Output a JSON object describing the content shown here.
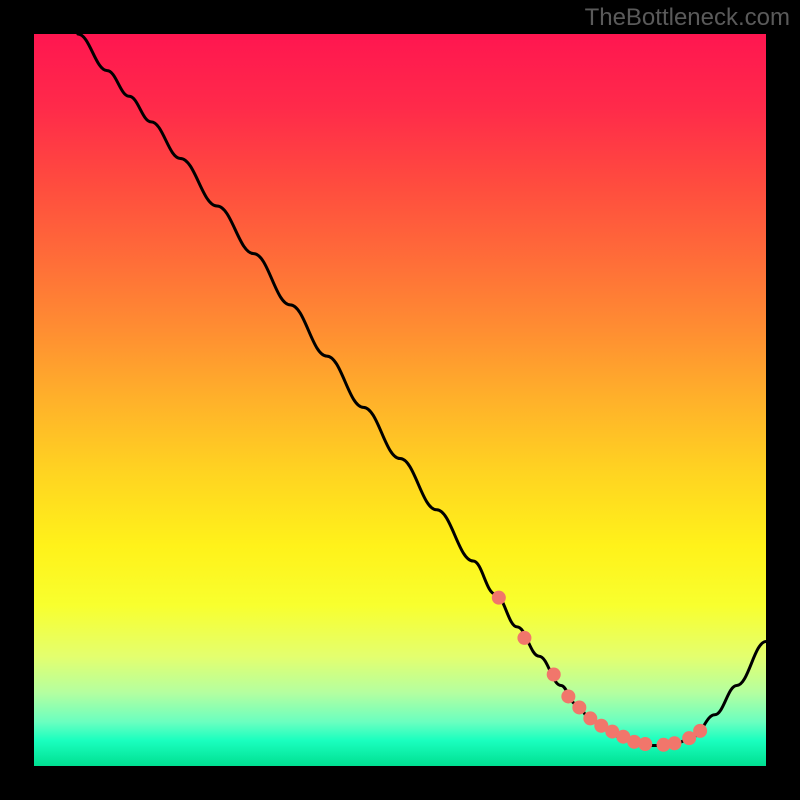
{
  "watermark": "TheBottleneck.com",
  "colors": {
    "background": "#000000",
    "curve": "#000000",
    "dot": "#f1766b",
    "gradient_stops": [
      {
        "offset": 0.0,
        "color": "#ff1650"
      },
      {
        "offset": 0.1,
        "color": "#ff2a4a"
      },
      {
        "offset": 0.2,
        "color": "#ff4a3f"
      },
      {
        "offset": 0.3,
        "color": "#ff6a39"
      },
      {
        "offset": 0.4,
        "color": "#ff8c32"
      },
      {
        "offset": 0.5,
        "color": "#ffb12a"
      },
      {
        "offset": 0.6,
        "color": "#ffd421"
      },
      {
        "offset": 0.7,
        "color": "#fff21a"
      },
      {
        "offset": 0.78,
        "color": "#f8ff2e"
      },
      {
        "offset": 0.85,
        "color": "#e4ff6e"
      },
      {
        "offset": 0.9,
        "color": "#b4ffa0"
      },
      {
        "offset": 0.94,
        "color": "#6affc0"
      },
      {
        "offset": 0.965,
        "color": "#1affbf"
      },
      {
        "offset": 1.0,
        "color": "#00e091"
      }
    ]
  },
  "chart_data": {
    "type": "line",
    "title": "",
    "xlabel": "",
    "ylabel": "",
    "xlim": [
      0,
      100
    ],
    "ylim": [
      0,
      100
    ],
    "series": [
      {
        "name": "bottleneck-curve",
        "x": [
          6,
          10,
          13,
          16,
          20,
          25,
          30,
          35,
          40,
          45,
          50,
          55,
          60,
          63,
          66,
          69,
          72,
          74,
          76,
          78,
          80,
          82,
          84,
          86,
          88,
          90,
          93,
          96,
          100
        ],
        "y": [
          100,
          95,
          91.5,
          88,
          83,
          76.5,
          70,
          63,
          56,
          49,
          42,
          35,
          28,
          23.5,
          19,
          15,
          11,
          8.5,
          6.5,
          5,
          4,
          3.2,
          2.8,
          2.8,
          3.2,
          4,
          7,
          11,
          17
        ]
      }
    ],
    "dots": {
      "name": "highlight-points",
      "x": [
        63.5,
        67,
        71,
        73,
        74.5,
        76,
        77.5,
        79,
        80.5,
        82,
        83.5,
        86,
        87.5,
        89.5,
        91
      ],
      "y": [
        23,
        17.5,
        12.5,
        9.5,
        8,
        6.5,
        5.5,
        4.7,
        4,
        3.3,
        3,
        2.9,
        3.1,
        3.8,
        4.8
      ]
    }
  }
}
